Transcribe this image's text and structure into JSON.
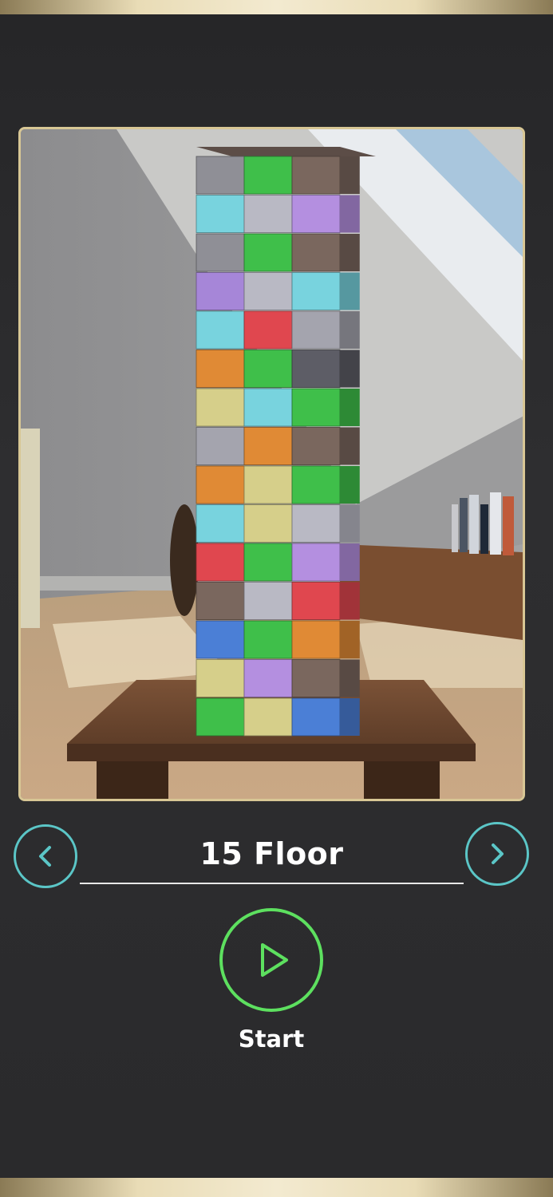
{
  "level": {
    "title": "15 Floor",
    "floors": 15
  },
  "controls": {
    "prev_icon": "chevron-left-icon",
    "next_icon": "chevron-right-icon",
    "start_icon": "play-icon",
    "start_label": "Start"
  },
  "colors": {
    "accent_teal": "#5bc6c7",
    "accent_green": "#5de05f",
    "frame_gold": "#d8c795"
  },
  "tower": {
    "layers": [
      [
        "#8f8f96",
        "#3fbf4a",
        "#7a675e"
      ],
      [
        "#78d3de",
        "#b9b9c4",
        "#b48fe0"
      ],
      [
        "#8f8f96",
        "#3fbf4a",
        "#7a675e"
      ],
      [
        "#a686d8",
        "#b9b9c4",
        "#78d3de"
      ],
      [
        "#78d3de",
        "#e0474f",
        "#a4a4ae"
      ],
      [
        "#e08a35",
        "#3fbf4a",
        "#5d5d66"
      ],
      [
        "#d6cf8a",
        "#78d3de",
        "#3fbf4a"
      ],
      [
        "#a4a4ae",
        "#e08a35",
        "#7a675e"
      ],
      [
        "#e08a35",
        "#d6cf8a",
        "#3fbf4a"
      ],
      [
        "#78d3de",
        "#d6cf8a",
        "#b9b9c4"
      ],
      [
        "#e0474f",
        "#3fbf4a",
        "#b48fe0"
      ],
      [
        "#7a675e",
        "#b9b9c4",
        "#e0474f"
      ],
      [
        "#4b7fd6",
        "#3fbf4a",
        "#e08a35"
      ],
      [
        "#d6cf8a",
        "#b48fe0",
        "#7a675e"
      ],
      [
        "#3fbf4a",
        "#d6cf8a",
        "#4b7fd6"
      ]
    ]
  }
}
